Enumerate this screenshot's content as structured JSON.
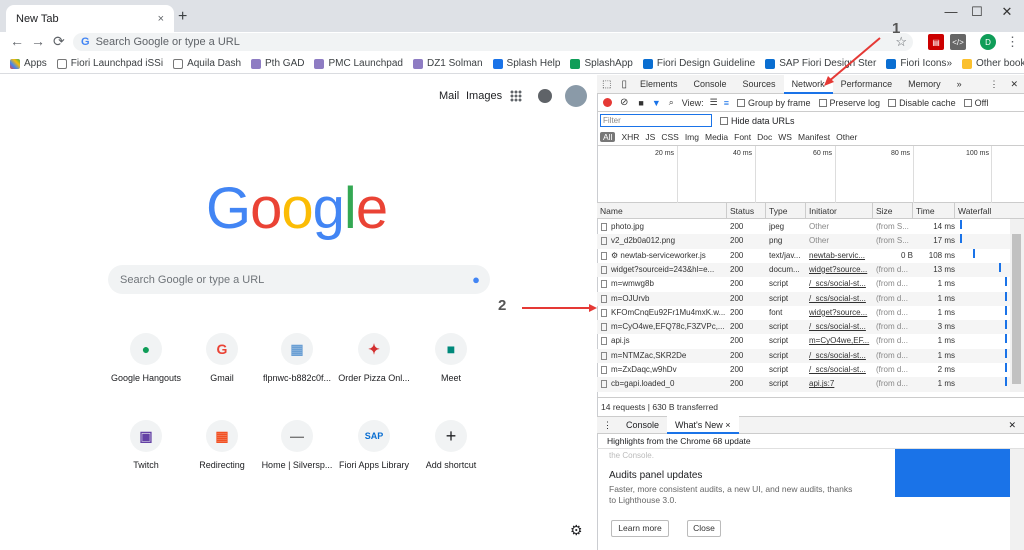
{
  "browser": {
    "tab_title": "New Tab",
    "tab_close": "×",
    "new_tab": "+",
    "min": "—",
    "max": "☐",
    "close": "✕",
    "back": "←",
    "forward": "→",
    "reload": "⟳",
    "omnibox_placeholder": "Search Google or type a URL",
    "g_letter": "G",
    "star": "☆",
    "profile_initial": "D",
    "menu": "⋮"
  },
  "bookmarks": {
    "items": [
      {
        "label": "Apps"
      },
      {
        "label": "Fiori Launchpad iSSi"
      },
      {
        "label": "Aquila Dash"
      },
      {
        "label": "Pth GAD"
      },
      {
        "label": "PMC Launchpad"
      },
      {
        "label": "DZ1 Solman"
      },
      {
        "label": "Splash Help"
      },
      {
        "label": "SplashApp"
      },
      {
        "label": "Fiori Design Guideline"
      },
      {
        "label": "SAP Fiori Design Ster"
      },
      {
        "label": "Fiori Icons"
      }
    ],
    "more": "»",
    "other": "Other bookmarks"
  },
  "newtab": {
    "mail": "Mail",
    "images": "Images",
    "logo": [
      "G",
      "o",
      "o",
      "g",
      "l",
      "e"
    ],
    "search_placeholder": "Search Google or type a URL",
    "mic": "🎤",
    "settings": "⚙",
    "tiles": [
      {
        "label": "Google Hangouts",
        "glyph": "●",
        "color": "#0f9d58"
      },
      {
        "label": "Gmail",
        "glyph": "G",
        "color": "#ea4335"
      },
      {
        "label": "flpnwc-b882c0f...",
        "glyph": "▦",
        "color": "#6a9fd4"
      },
      {
        "label": "Order Pizza Onl...",
        "glyph": "✦",
        "color": "#d32f2f"
      },
      {
        "label": "Meet",
        "glyph": "■",
        "color": "#00897b"
      },
      {
        "label": "Twitch",
        "glyph": "▣",
        "color": "#6441a5"
      },
      {
        "label": "Redirecting",
        "glyph": "▦",
        "color": "#f25022"
      },
      {
        "label": "Home | Silversp...",
        "glyph": "—",
        "color": "#777"
      },
      {
        "label": "Fiori Apps Library",
        "glyph": "SAP",
        "color": "#0a6ed1"
      },
      {
        "label": "Add shortcut",
        "glyph": "+",
        "color": "#202124"
      }
    ]
  },
  "devtools": {
    "tabs": [
      "Elements",
      "Console",
      "Sources",
      "Network",
      "Performance",
      "Memory"
    ],
    "more_tabs": "»",
    "menu": "⋮",
    "close": "✕",
    "toolbar": {
      "view_label": "View:",
      "group_by_frame": "Group by frame",
      "preserve_log": "Preserve log",
      "disable_cache": "Disable cache",
      "offline": "Offl"
    },
    "filter_placeholder": "Filter",
    "hide_data_urls": "Hide data URLs",
    "types": [
      "All",
      "XHR",
      "JS",
      "CSS",
      "Img",
      "Media",
      "Font",
      "Doc",
      "WS",
      "Manifest",
      "Other"
    ],
    "ticks": [
      "20 ms",
      "40 ms",
      "60 ms",
      "80 ms",
      "100 ms"
    ],
    "columns": [
      "Name",
      "Status",
      "Type",
      "Initiator",
      "Size",
      "Time",
      "Waterfall"
    ],
    "rows": [
      {
        "name": "photo.jpg",
        "status": "200",
        "type": "jpeg",
        "initiator": "Other",
        "size": "(from S...",
        "time": "14 ms"
      },
      {
        "name": "v2_d2b0a012.png",
        "status": "200",
        "type": "png",
        "initiator": "Other",
        "size": "(from S...",
        "time": "17 ms"
      },
      {
        "name": "⚙ newtab-serviceworker.js",
        "status": "200",
        "type": "text/jav...",
        "initiator": "newtab-servic...",
        "size": "0 B",
        "time": "108 ms"
      },
      {
        "name": "widget?sourceid=243&hl=e...",
        "status": "200",
        "type": "docum...",
        "initiator": "widget?source...",
        "size": "(from d...",
        "time": "13 ms"
      },
      {
        "name": "m=wmwg8b",
        "status": "200",
        "type": "script",
        "initiator": "/_scs/social-st...",
        "size": "(from d...",
        "time": "1 ms"
      },
      {
        "name": "m=OJUrvb",
        "status": "200",
        "type": "script",
        "initiator": "/_scs/social-st...",
        "size": "(from d...",
        "time": "1 ms"
      },
      {
        "name": "KFOmCnqEu92Fr1Mu4mxK.w...",
        "status": "200",
        "type": "font",
        "initiator": "widget?source...",
        "size": "(from d...",
        "time": "1 ms"
      },
      {
        "name": "m=CyO4we,EFQ78c,F3ZVPc,...",
        "status": "200",
        "type": "script",
        "initiator": "/_scs/social-st...",
        "size": "(from d...",
        "time": "3 ms"
      },
      {
        "name": "api.js",
        "status": "200",
        "type": "script",
        "initiator": "m=CyO4we,EF...",
        "size": "(from d...",
        "time": "1 ms"
      },
      {
        "name": "m=NTMZac,SKR2De",
        "status": "200",
        "type": "script",
        "initiator": "/_scs/social-st...",
        "size": "(from d...",
        "time": "1 ms"
      },
      {
        "name": "m=ZxDaqc,w9hDv",
        "status": "200",
        "type": "script",
        "initiator": "/_scs/social-st...",
        "size": "(from d...",
        "time": "2 ms"
      },
      {
        "name": "cb=gapi.loaded_0",
        "status": "200",
        "type": "script",
        "initiator": "api.js:7",
        "size": "(from d...",
        "time": "1 ms"
      }
    ],
    "status_text": "14 requests | 630 B transferred",
    "drawer_tabs": [
      "Console",
      "What's New"
    ],
    "drawer_tab_close": "×",
    "highlights": "Highlights from the Chrome 68 update",
    "faded_text": "the Console.",
    "audits_title": "Audits panel updates",
    "audits_body": "Faster, more consistent audits, a new UI, and new audits, thanks to Lighthouse 3.0.",
    "learn_more": "Learn more",
    "close_btn": "Close"
  },
  "annotations": {
    "one": "1",
    "two": "2"
  }
}
